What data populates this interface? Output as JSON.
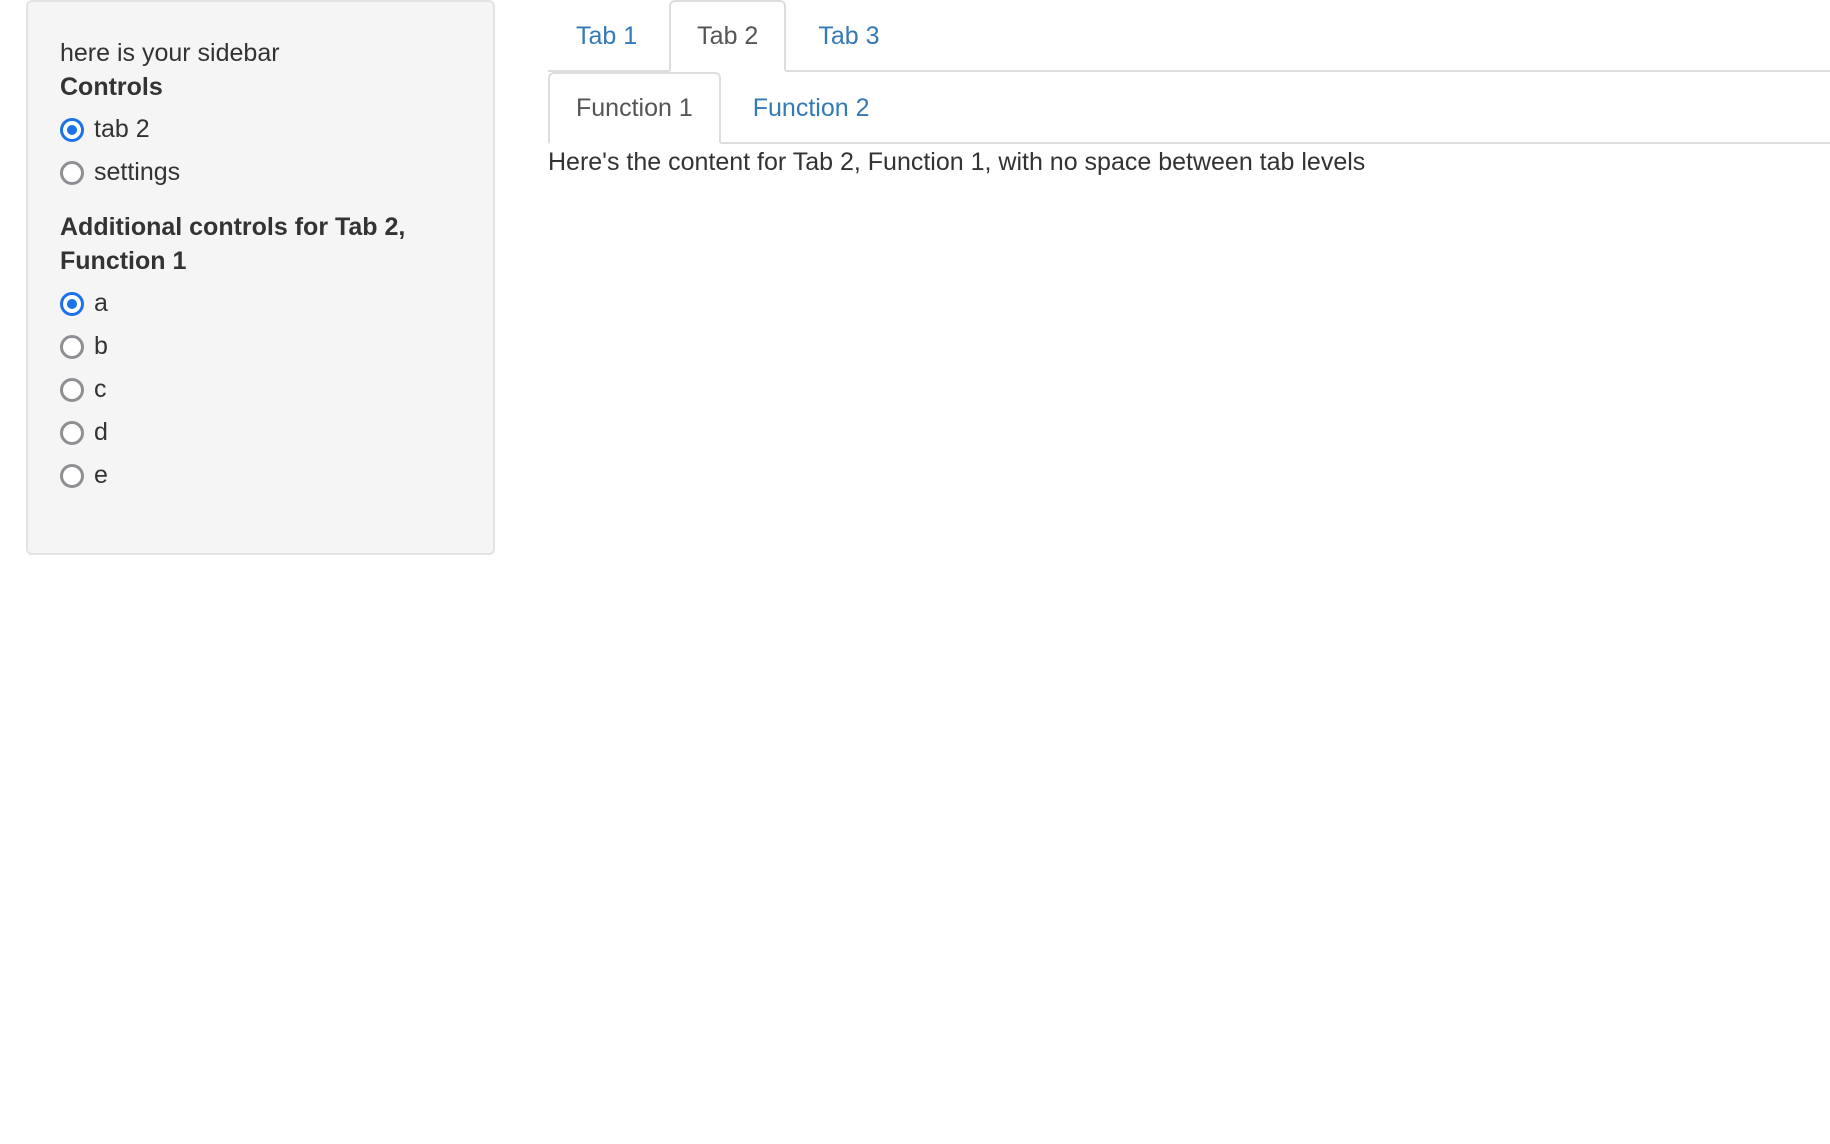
{
  "sidebar": {
    "intro": "here is your sidebar",
    "controls_label": "Controls",
    "controls_options": [
      {
        "label": "tab 2",
        "checked": true
      },
      {
        "label": "settings",
        "checked": false
      }
    ],
    "additional_label": "Additional controls for Tab 2, Function 1",
    "additional_options": [
      {
        "label": "a",
        "checked": true
      },
      {
        "label": "b",
        "checked": false
      },
      {
        "label": "c",
        "checked": false
      },
      {
        "label": "d",
        "checked": false
      },
      {
        "label": "e",
        "checked": false
      }
    ]
  },
  "tabs": [
    {
      "label": "Tab 1",
      "active": false
    },
    {
      "label": "Tab 2",
      "active": true
    },
    {
      "label": "Tab 3",
      "active": false
    }
  ],
  "subtabs": [
    {
      "label": "Function 1",
      "active": true
    },
    {
      "label": "Function 2",
      "active": false
    }
  ],
  "content": {
    "text": "Here's the content for Tab 2, Function 1, with no space between tab levels"
  },
  "colors": {
    "link": "#337ab7",
    "radio_checked": "#1a73e8",
    "sidebar_bg": "#f5f5f5"
  }
}
